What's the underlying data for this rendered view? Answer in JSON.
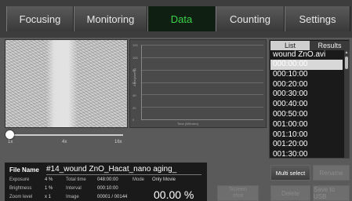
{
  "tabs": [
    {
      "label": "Focusing",
      "active": false
    },
    {
      "label": "Monitoring",
      "active": false
    },
    {
      "label": "Data",
      "active": true
    },
    {
      "label": "Counting",
      "active": false
    },
    {
      "label": "Settings",
      "active": false
    }
  ],
  "graph": {
    "yticks": [
      "120",
      "100",
      "80",
      "60",
      "40",
      "20",
      "0"
    ],
    "ylabel": "Area(pixel%)",
    "xlabel": "Time (48h:mm)"
  },
  "zoom": {
    "ticks": [
      "1x",
      "4x",
      "16x"
    ],
    "level": 0
  },
  "list_panel": {
    "tab_list": "List",
    "tab_results": "Results",
    "filename": "wound ZnO.avi",
    "items": [
      "000:00:00",
      "000:10:00",
      "000:20:00",
      "000:30:00",
      "000:40:00",
      "000:50:00",
      "001:00:00",
      "001:10:00",
      "001:20:00",
      "001:30:00"
    ],
    "selected_index": 0,
    "scroll_up": "▲"
  },
  "buttons": {
    "multi_select": "Multi select",
    "rename": "Rename",
    "delete": "Delete",
    "save_to_usb": "Save to USB",
    "screen_shot_line1": "Screen",
    "screen_shot_line2": "shot"
  },
  "info": {
    "file_name_label": "File Name",
    "file_name_value": "#14_wound ZnO_Hacat_nano aging_",
    "exposure_label": "Exposure",
    "exposure_value": "4 %",
    "brightness_label": "Brightness",
    "brightness_value": "1 %",
    "zoom_label": "Zoom level",
    "zoom_value": "x 1",
    "total_time_label": "Total time",
    "total_time_value": "048:00:00",
    "interval_label": "Interval",
    "interval_value": "000:10:00",
    "image_label": "Image",
    "image_value": "00001 / 00144",
    "mode_label": "Mode",
    "mode_value": "Only Movie",
    "progress": "00.00 %"
  },
  "colors": {
    "active_tab_text": "#3cd24a",
    "active_tab_bg": "#0f1f12"
  }
}
